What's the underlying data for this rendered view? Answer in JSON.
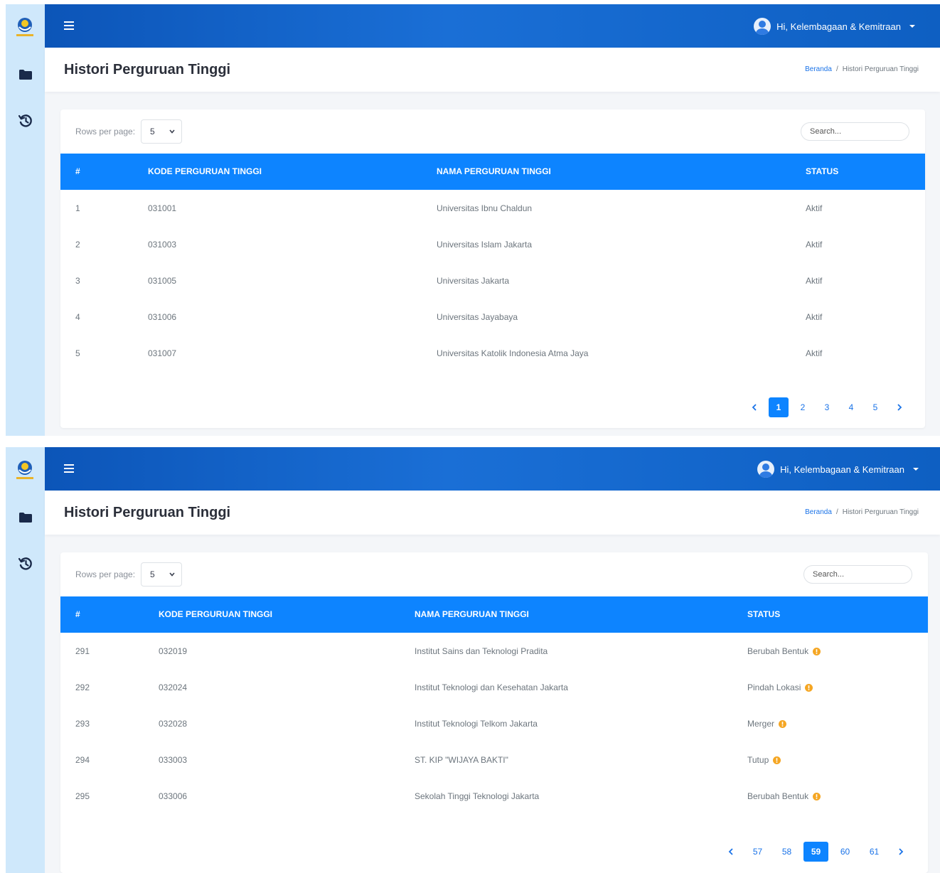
{
  "app": {
    "user_greeting": "Hi, Kelembagaan & Kemitraan"
  },
  "colors": {
    "topbar": "#0c55b8",
    "sidebar": "#cfe8fb",
    "table_header": "#0d84ff",
    "accent": "#1a73e8",
    "warning": "#f5a623"
  },
  "sidebar": {
    "items": [
      {
        "icon": "folder-icon"
      },
      {
        "icon": "history-icon"
      }
    ]
  },
  "page": {
    "title": "Histori Perguruan Tinggi"
  },
  "breadcrumb": {
    "home": "Beranda",
    "separator": "/",
    "current": "Histori Perguruan Tinggi"
  },
  "table_controls": {
    "rows_per_page_label": "Rows per page:",
    "rows_per_page_value": "5",
    "search_placeholder": "Search..."
  },
  "columns": [
    "#",
    "KODE PERGURUAN TINGGI",
    "NAMA PERGURUAN TINGGI",
    "STATUS"
  ],
  "views": [
    {
      "rows": [
        {
          "no": "1",
          "kode": "031001",
          "nama": "Universitas Ibnu Chaldun",
          "status": "Aktif"
        },
        {
          "no": "2",
          "kode": "031003",
          "nama": "Universitas Islam Jakarta",
          "status": "Aktif"
        },
        {
          "no": "3",
          "kode": "031005",
          "nama": "Universitas Jakarta",
          "status": "Aktif"
        },
        {
          "no": "4",
          "kode": "031006",
          "nama": "Universitas Jayabaya",
          "status": "Aktif"
        },
        {
          "no": "5",
          "kode": "031007",
          "nama": "Universitas Katolik Indonesia Atma Jaya",
          "status": "Aktif"
        }
      ],
      "pages": [
        "1",
        "2",
        "3",
        "4",
        "5"
      ],
      "active_page": "1"
    },
    {
      "rows": [
        {
          "no": "291",
          "kode": "032019",
          "nama": "Institut Sains dan Teknologi Pradita",
          "status": "Berubah Bentuk"
        },
        {
          "no": "292",
          "kode": "032024",
          "nama": "Institut Teknologi dan Kesehatan Jakarta",
          "status": "Pindah Lokasi"
        },
        {
          "no": "293",
          "kode": "032028",
          "nama": "Institut Teknologi Telkom Jakarta",
          "status": "Merger"
        },
        {
          "no": "294",
          "kode": "033003",
          "nama": "ST. KIP \"WIJAYA BAKTI\"",
          "status": "Tutup"
        },
        {
          "no": "295",
          "kode": "033006",
          "nama": "Sekolah Tinggi Teknologi Jakarta",
          "status": "Berubah Bentuk"
        }
      ],
      "pages": [
        "57",
        "58",
        "59",
        "60",
        "61"
      ],
      "active_page": "59"
    }
  ]
}
